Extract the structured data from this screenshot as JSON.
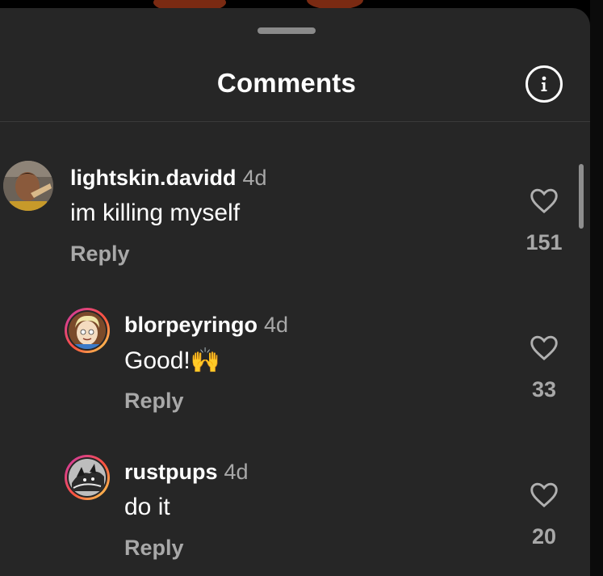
{
  "sheet": {
    "title": "Comments",
    "info_icon": "info-icon"
  },
  "comments": [
    {
      "username": "lightskin.davidd",
      "time": "4d",
      "text": "im killing myself",
      "reply_label": "Reply",
      "likes": "151",
      "avatar_icon": "avatar-photo"
    },
    {
      "username": "blorpeyringo",
      "time": "4d",
      "text": "Good!🙌",
      "reply_label": "Reply",
      "likes": "33",
      "avatar_icon": "avatar-cartoon"
    },
    {
      "username": "rustpups",
      "time": "4d",
      "text": "do it",
      "reply_label": "Reply",
      "likes": "20",
      "avatar_icon": "avatar-dog"
    }
  ],
  "colors": {
    "sheet_bg": "#262626",
    "secondary_text": "#a8a8a8",
    "story_ring_start": "#c837ab",
    "story_ring_end": "#ffdd55"
  }
}
